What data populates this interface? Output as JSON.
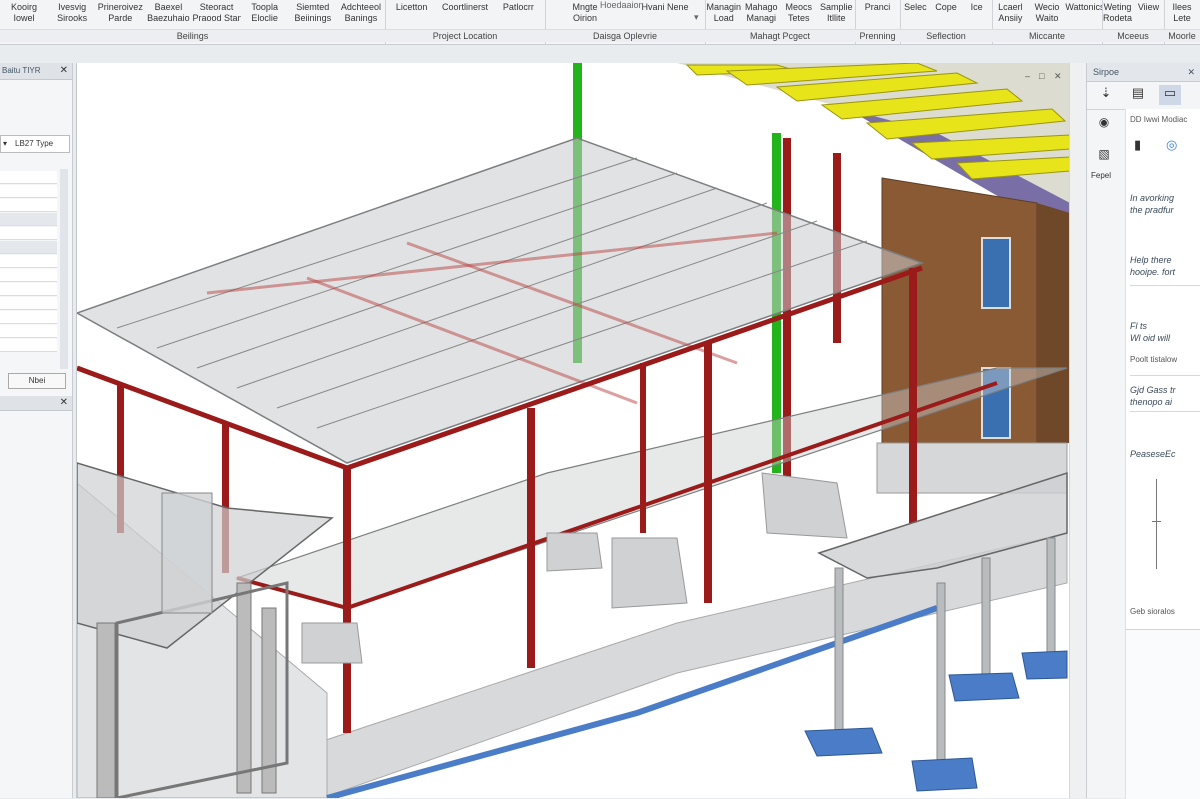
{
  "ribbon": {
    "groups": [
      {
        "label": "Beilings",
        "buttons": [
          {
            "l1": "Kooirg",
            "l2": "Iowel"
          },
          {
            "l1": "Ivesvig",
            "l2": "Sirooks"
          },
          {
            "l1": "Prineroivez",
            "l2": "Parde"
          },
          {
            "l1": "Baexel",
            "l2": "Baezuhaio"
          },
          {
            "l1": "Steoract",
            "l2": "Praood Standards"
          },
          {
            "l1": "Toopla",
            "l2": "Eloclie"
          },
          {
            "l1": "Siemted",
            "l2": "Beiinings"
          },
          {
            "l1": "Adchteeol",
            "l2": "Banings"
          }
        ]
      },
      {
        "label": "Project Location",
        "buttons": [
          {
            "l1": "Licetton",
            "l2": ""
          },
          {
            "l1": "Coortlinerst",
            "l2": ""
          },
          {
            "l1": "Patlocrr",
            "l2": ""
          }
        ]
      },
      {
        "label": "Daisga Oplevrie",
        "buttons": [
          {
            "l1": "Mngte",
            "l2": "Oirion"
          },
          {
            "l1": "Hvani Nene",
            "l2": ""
          }
        ]
      },
      {
        "label": "Mahagt Pcgect",
        "buttons": [
          {
            "l1": "Managin",
            "l2": "Load"
          },
          {
            "l1": "Mahago",
            "l2": "Managi"
          },
          {
            "l1": "Meocs",
            "l2": "Tetes"
          },
          {
            "l1": "Samplie",
            "l2": "Itllite"
          }
        ]
      },
      {
        "label": "Prenning",
        "buttons": [
          {
            "l1": "Pranci",
            "l2": ""
          }
        ]
      },
      {
        "label": "Seflection",
        "buttons": [
          {
            "l1": "Selec",
            "l2": ""
          },
          {
            "l1": "Cope",
            "l2": ""
          },
          {
            "l1": "Ice",
            "l2": ""
          }
        ]
      },
      {
        "label": "Miccante",
        "buttons": [
          {
            "l1": "Lcaerl",
            "l2": "Ansiiy"
          },
          {
            "l1": "Wecio",
            "l2": "Waito"
          },
          {
            "l1": "Wattonics",
            "l2": ""
          }
        ]
      },
      {
        "label": "Mceeus",
        "buttons": [
          {
            "l1": "Weting",
            "l2": "Rodeta"
          },
          {
            "l1": "Viiew",
            "l2": ""
          }
        ]
      },
      {
        "label": "Moorle",
        "buttons": [
          {
            "l1": "Ilees",
            "l2": "Lete"
          }
        ]
      }
    ],
    "dropdown_hint": "Hoedaaion"
  },
  "left_panel": {
    "title": "Baitu TIYR",
    "close": "✕",
    "type_selector": "LB27 Type",
    "apply_button": "Nbei"
  },
  "right_panel": {
    "title": "Sirpoe",
    "close": "✕",
    "section_label": "DD Iwwi Modiac",
    "side_label": "Fepel",
    "lines": [
      "In avorking",
      "the pradfur",
      "Help there",
      "hooipe. fort",
      "Fl ts",
      "Wl oid will",
      "Poolt tistalow",
      "Gjd Gass tr",
      "thenopo ai",
      "PeaseseEc",
      "Geb sioralos"
    ]
  },
  "viewport": {
    "controls": [
      "–",
      "□",
      "✕"
    ]
  },
  "colors": {
    "steel_red": "#9b1b1b",
    "column_green": "#22b41a",
    "joist_yellow": "#e8e41a",
    "roof_purple": "#5e5390",
    "footing_blue": "#4a7cc7",
    "wall_brown": "#8a5a35",
    "concrete_grey": "#cfd1d3"
  }
}
